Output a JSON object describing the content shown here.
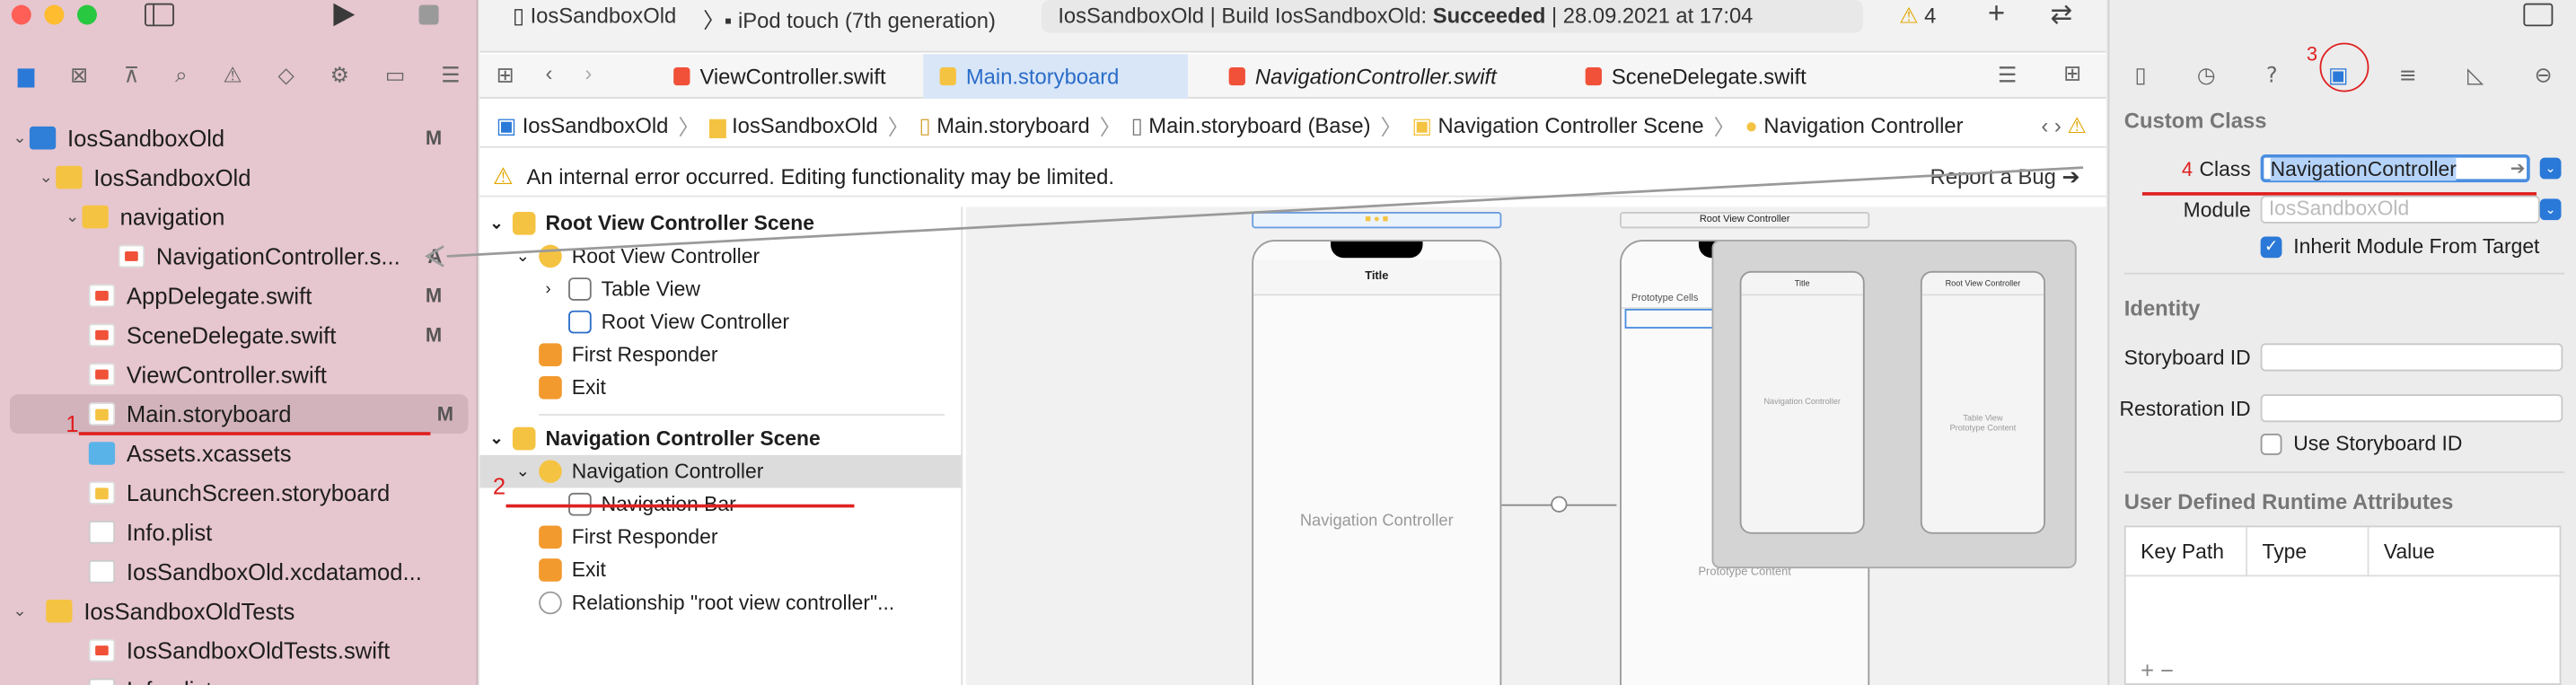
{
  "navigator": {
    "items": [
      {
        "label": "IosSandboxOld",
        "badge": "M"
      },
      {
        "label": "IosSandboxOld",
        "badge": ""
      },
      {
        "label": "navigation",
        "badge": ""
      },
      {
        "label": "NavigationController.s...",
        "badge": "A"
      },
      {
        "label": "AppDelegate.swift",
        "badge": "M"
      },
      {
        "label": "SceneDelegate.swift",
        "badge": "M"
      },
      {
        "label": "ViewController.swift",
        "badge": ""
      },
      {
        "label": "Main.storyboard",
        "badge": "M"
      },
      {
        "label": "Assets.xcassets",
        "badge": ""
      },
      {
        "label": "LaunchScreen.storyboard",
        "badge": ""
      },
      {
        "label": "Info.plist",
        "badge": ""
      },
      {
        "label": "IosSandboxOld.xcdatamod...",
        "badge": ""
      },
      {
        "label": "IosSandboxOldTests",
        "badge": ""
      },
      {
        "label": "IosSandboxOldTests.swift",
        "badge": ""
      },
      {
        "label": "Info.plist",
        "badge": ""
      }
    ]
  },
  "toolbar": {
    "scheme": "IosSandboxOld",
    "device": "iPod touch (7th generation)",
    "activity_prefix": "IosSandboxOld | Build IosSandboxOld: ",
    "activity_status": "Succeeded",
    "activity_suffix": " | 28.09.2021 at 17:04",
    "warning_count": "4"
  },
  "tabs": [
    {
      "label": "ViewController.swift"
    },
    {
      "label": "Main.storyboard"
    },
    {
      "label": "NavigationController.swift"
    },
    {
      "label": "SceneDelegate.swift"
    }
  ],
  "breadcrumb": [
    "IosSandboxOld",
    "IosSandboxOld",
    "Main.storyboard",
    "Main.storyboard (Base)",
    "Navigation Controller Scene",
    "Navigation Controller"
  ],
  "notice": {
    "text": "An internal error occurred. Editing functionality may be limited.",
    "report": "Report a Bug"
  },
  "outline": {
    "scene1": "Root View Controller Scene",
    "s1_items": [
      "Root View Controller",
      "Table View",
      "Root View Controller",
      "First Responder",
      "Exit"
    ],
    "scene2": "Navigation Controller Scene",
    "s2_items": [
      "Navigation Controller",
      "Navigation Bar",
      "First Responder",
      "Exit",
      "Relationship \"root view controller\"..."
    ]
  },
  "canvas": {
    "phone1_title": "Title",
    "phone1_center": "Navigation Controller",
    "scene2_label": "Root View Controller",
    "prototype_cells": "Prototype Cells",
    "prototype_content": "Prototype Content",
    "mini1_title": "Title",
    "mini1_center": "Navigation Controller",
    "mini2_title": "Root View Controller",
    "mini2_center": "Table View",
    "mini2_sub": "Prototype Content"
  },
  "inspector": {
    "custom_class": "Custom Class",
    "class_label": "Class",
    "class_value": "NavigationController",
    "module_label": "Module",
    "module_placeholder": "IosSandboxOld",
    "inherit_label": "Inherit Module From Target",
    "identity": "Identity",
    "storyboard_id": "Storyboard ID",
    "restoration_id": "Restoration ID",
    "use_storyboard_id": "Use Storyboard ID",
    "udra": "User Defined Runtime Attributes",
    "col_key": "Key Path",
    "col_type": "Type",
    "col_value": "Value"
  },
  "annotations": [
    "1",
    "2",
    "3",
    "4"
  ],
  "colors": {
    "accent": "#2a79d8",
    "annotation": "#e02020",
    "navigator_bg": "#e6c6cf"
  }
}
